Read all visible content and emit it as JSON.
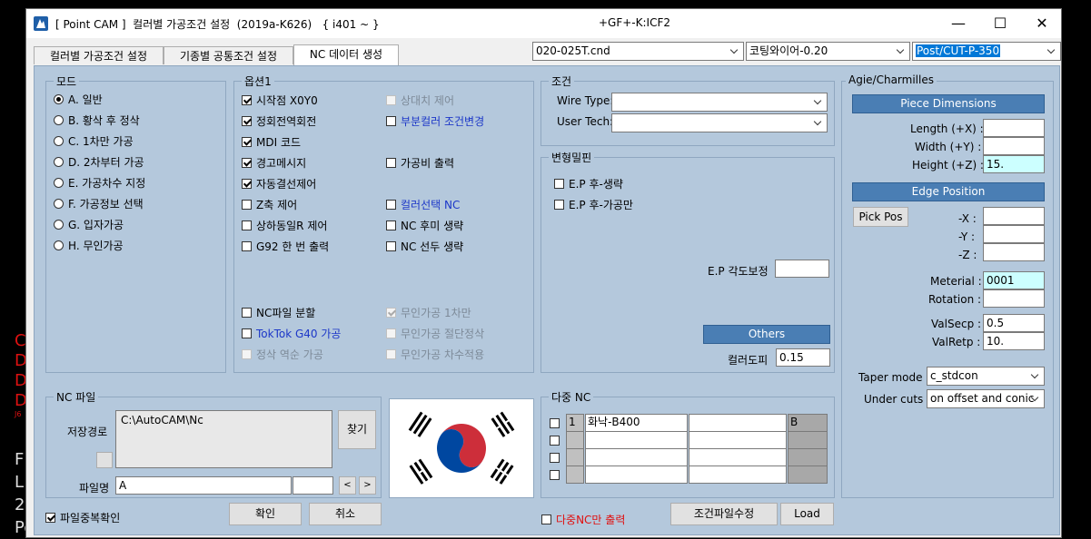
{
  "window": {
    "title": "[ Point CAM ]  컬러별 가공조건 설정  (2019a-K626)   { i401 ~ }",
    "center_title": "+GF+-K:ICF2",
    "controls": {
      "minimize": "—",
      "maximize": "☐",
      "close": "✕"
    }
  },
  "tabs": [
    {
      "label": "컬러별 가공조건 설정"
    },
    {
      "label": "기종별 공통조건 설정"
    },
    {
      "label": "NC 데이터 생성"
    }
  ],
  "top_combos": {
    "file": "020-025T.cnd",
    "wire": "코팅와이어-0.20",
    "post": "Post/CUT-P-350"
  },
  "mode": {
    "title": "모드",
    "items": [
      {
        "label": "A. 일반",
        "checked": true
      },
      {
        "label": "B. 황삭 후 정삭",
        "checked": false
      },
      {
        "label": "C. 1차만 가공",
        "checked": false
      },
      {
        "label": "D. 2차부터 가공",
        "checked": false
      },
      {
        "label": "E. 가공차수 지정",
        "checked": false
      },
      {
        "label": "F. 가공정보 선택",
        "checked": false
      },
      {
        "label": "G. 입자가공",
        "checked": false
      },
      {
        "label": "H. 무인가공",
        "checked": false
      }
    ]
  },
  "options": {
    "title": "옵션1",
    "left": [
      {
        "label": "시작점 X0Y0",
        "checked": true
      },
      {
        "label": "정회전역회전",
        "checked": true
      },
      {
        "label": "MDI 코드",
        "checked": true
      },
      {
        "label": "경고메시지",
        "checked": true
      },
      {
        "label": "자동결선제어",
        "checked": true
      },
      {
        "label": "Z축 제어",
        "checked": false
      },
      {
        "label": "상하동일R 제어",
        "checked": false
      },
      {
        "label": "G92 한 번 출력",
        "checked": false
      }
    ],
    "right": [
      {
        "label": "상대치 제어",
        "checked": false,
        "style": "gray"
      },
      {
        "label": "부분컬러 조건변경",
        "checked": false,
        "style": "blue"
      },
      {
        "label": "가공비 출력",
        "checked": false,
        "style": ""
      },
      {
        "label": "컬러선택 NC",
        "checked": false,
        "style": "blue"
      },
      {
        "label": "NC 후미 생략",
        "checked": false,
        "style": ""
      },
      {
        "label": "NC 선두 생략",
        "checked": false,
        "style": ""
      }
    ],
    "bottom_left": [
      {
        "label": "NC파일 분할",
        "checked": false,
        "style": ""
      },
      {
        "label": "TokTok  G40 가공",
        "checked": false,
        "style": "blue"
      },
      {
        "label": "정삭 역순 가공",
        "checked": false,
        "style": "gray"
      }
    ],
    "bottom_right": [
      {
        "label": "무인가공 1차만",
        "checked": true,
        "style": "gray"
      },
      {
        "label": "무인가공 절단정삭",
        "checked": false,
        "style": "gray"
      },
      {
        "label": "무인가공 차수적용",
        "checked": false,
        "style": "gray"
      }
    ]
  },
  "condition": {
    "title": "조건",
    "wire_type_label": "Wire Type:",
    "wire_type_value": "",
    "user_tech_label": "User Tech:",
    "user_tech_value": ""
  },
  "deform": {
    "title": "변형밀핀",
    "items": [
      {
        "label": "E.P 후-생략",
        "checked": false
      },
      {
        "label": "E.P 후-가공만",
        "checked": false
      }
    ],
    "angle_label": "E.P 각도보정",
    "angle_value": "",
    "others_label": "Others",
    "color_depth_label": "컬러도피",
    "color_depth_value": "0.15"
  },
  "agie": {
    "title": "Agie/Charmilles",
    "piece_header": "Piece Dimensions",
    "length_label": "Length (+X) :",
    "length_value": "",
    "width_label": "Width (+Y) :",
    "width_value": "",
    "height_label": "Height (+Z) :",
    "height_value": "15.",
    "edge_header": "Edge Position",
    "pick_pos": "Pick Pos",
    "x_label": "-X :",
    "x_value": "",
    "y_label": "-Y :",
    "y_value": "",
    "z_label": "-Z :",
    "z_value": "",
    "material_label": "Meterial :",
    "material_value": "0001",
    "rotation_label": "Rotation :",
    "rotation_value": "",
    "valsecp_label": "ValSecp :",
    "valsecp_value": "0.5",
    "valretp_label": "ValRetp :",
    "valretp_value": "10.",
    "taper_label": "Taper mode :",
    "taper_value": "c_stdcon",
    "undercut_label": "Under cuts :",
    "undercut_value": "on offset and conic"
  },
  "ncfile": {
    "title": "NC 파일",
    "save_path_label": "저장경로",
    "save_path_value": "C:\\AutoCAM\\Nc",
    "browse_label": "찾기",
    "filename_label": "파일명",
    "filename_value": "A",
    "filename_ext": "",
    "prev": "<",
    "next": ">"
  },
  "multi_nc": {
    "title": "다중 NC",
    "rows": [
      {
        "num": "1",
        "name": "화낙-B400",
        "extra": "",
        "tag": "B"
      },
      {
        "num": "",
        "name": "",
        "extra": "",
        "tag": ""
      },
      {
        "num": "",
        "name": "",
        "extra": "",
        "tag": ""
      },
      {
        "num": "",
        "name": "",
        "extra": "",
        "tag": ""
      }
    ]
  },
  "bottom": {
    "dup_check_label": "파일중복확인",
    "ok_label": "확인",
    "cancel_label": "취소",
    "multi_only_label": "다중NC만 출력",
    "edit_cond_label": "조건파일수정",
    "load_label": "Load"
  },
  "background_text": {
    "left_chars": [
      "C",
      "D",
      "D",
      "D",
      "J6",
      "F",
      "L",
      "2",
      "Pos"
    ]
  },
  "colors": {
    "panel": "#b4c8dc",
    "header_blue": "#4a7eb4",
    "cyan_field": "#ccffff",
    "selection": "#0078d7"
  }
}
